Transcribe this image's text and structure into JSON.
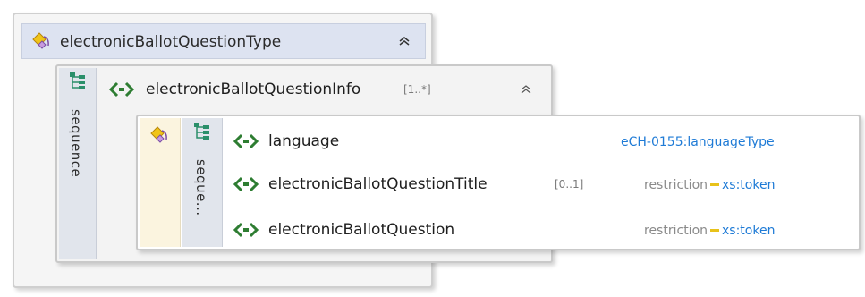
{
  "outer": {
    "title": "electronicBallotQuestionType"
  },
  "middle": {
    "title": "electronicBallotQuestionInfo",
    "cardinality": "[1..*]",
    "group_label": "sequence"
  },
  "inner": {
    "group_label": "seque...",
    "rows": [
      {
        "name": "language",
        "cardinality": "",
        "type_text": "eCH-0155:languageType",
        "restriction": "",
        "base": ""
      },
      {
        "name": "electronicBallotQuestionTitle",
        "cardinality": "[0..1]",
        "type_text": "",
        "restriction": "restriction",
        "base": "xs:token"
      },
      {
        "name": "electronicBallotQuestion",
        "cardinality": "",
        "type_text": "",
        "restriction": "restriction",
        "base": "xs:token"
      }
    ]
  },
  "colors": {
    "element_icon": "#2e7d32",
    "type_link": "#1f7bd6",
    "restriction_dash": "#e8c21a",
    "sequence_icon": "#2a8f6a",
    "header_bg": "#dde3f1"
  },
  "icons": [
    "complex-type-icon",
    "element-icon",
    "sequence-icon",
    "collapse-chevron-icon"
  ]
}
